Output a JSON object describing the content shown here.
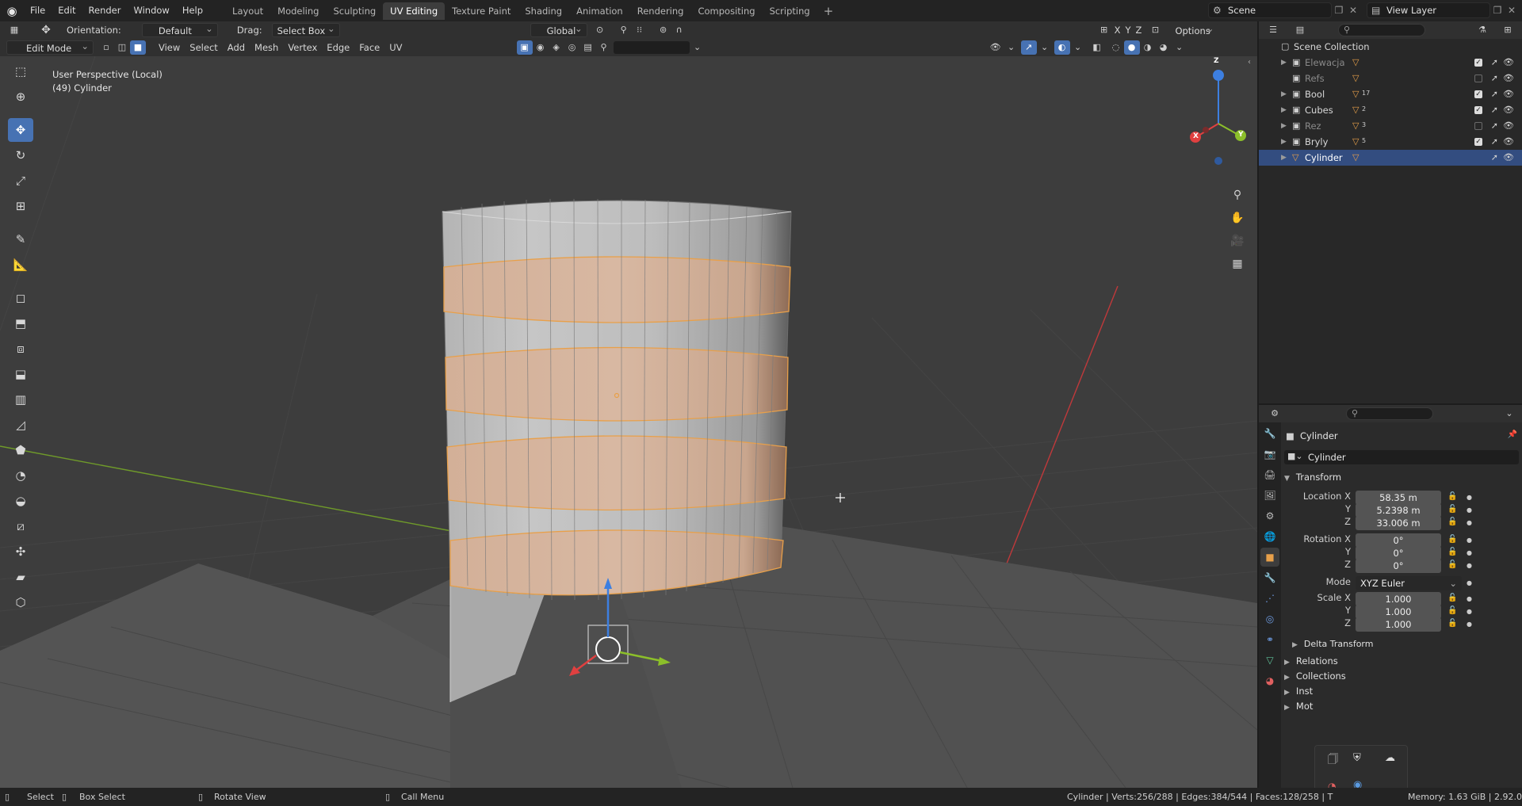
{
  "menu": [
    "File",
    "Edit",
    "Render",
    "Window",
    "Help"
  ],
  "workspaces": [
    "Layout",
    "Modeling",
    "Sculpting",
    "UV Editing",
    "Texture Paint",
    "Shading",
    "Animation",
    "Rendering",
    "Compositing",
    "Scripting"
  ],
  "active_workspace": "UV Editing",
  "scene": "Scene",
  "view_layer": "View Layer",
  "header1": {
    "orientation_label": "Orientation:",
    "orientation_value": "Default",
    "drag_label": "Drag:",
    "drag_value": "Select Box",
    "transform_orientation": "Global",
    "axes": [
      "X",
      "Y",
      "Z"
    ],
    "options": "Options"
  },
  "header2": {
    "mode": "Edit Mode",
    "menus": [
      "View",
      "Select",
      "Add",
      "Mesh",
      "Vertex",
      "Edge",
      "Face",
      "UV"
    ]
  },
  "viewport": {
    "perspective": "User Perspective (Local)",
    "object_info": "(49) Cylinder",
    "gizmo_axes": [
      "X",
      "Y",
      "Z"
    ]
  },
  "outliner": {
    "root": "Scene Collection",
    "items": [
      {
        "name": "Elewacja",
        "dim": true,
        "checked": true,
        "expand": true
      },
      {
        "name": "Refs",
        "dim": true,
        "checked": false,
        "expand": false
      },
      {
        "name": "Bool",
        "dim": false,
        "checked": true,
        "expand": true,
        "badge": "17"
      },
      {
        "name": "Cubes",
        "dim": false,
        "checked": true,
        "expand": true,
        "badge": "2"
      },
      {
        "name": "Rez",
        "dim": true,
        "checked": false,
        "expand": true,
        "badge": "3"
      },
      {
        "name": "Bryly",
        "dim": false,
        "checked": true,
        "expand": true,
        "badge": "5"
      },
      {
        "name": "Cylinder",
        "dim": false,
        "checked": null,
        "expand": true,
        "selected": true
      }
    ]
  },
  "properties": {
    "object_name": "Cylinder",
    "name_field": "Cylinder",
    "transform_title": "Transform",
    "location_label": "Location X",
    "location": [
      "58.35 m",
      "5.2398 m",
      "33.006 m"
    ],
    "rotation_label": "Rotation X",
    "rotation": [
      "0°",
      "0°",
      "0°"
    ],
    "mode_label": "Mode",
    "mode_value": "XYZ Euler",
    "scale_label": "Scale X",
    "scale": [
      "1.000",
      "1.000",
      "1.000"
    ],
    "axis_y": "Y",
    "axis_z": "Z",
    "delta_transform": "Delta Transform",
    "relations": "Relations",
    "collections": "Collections",
    "instancing": "Inst",
    "motion": "Mot"
  },
  "statusbar": {
    "select": "Select",
    "box_select": "Box Select",
    "rotate_view": "Rotate View",
    "call_menu": "Call Menu",
    "stats": "Cylinder | Verts:256/288 | Edges:384/544 | Faces:128/258 | T",
    "memory": "Memory: 1.63 GiB | 2.92.0"
  },
  "colors": {
    "accent": "#4772b3",
    "selection": "#e8a04a",
    "viewport_bg": "#3d3d3d"
  }
}
